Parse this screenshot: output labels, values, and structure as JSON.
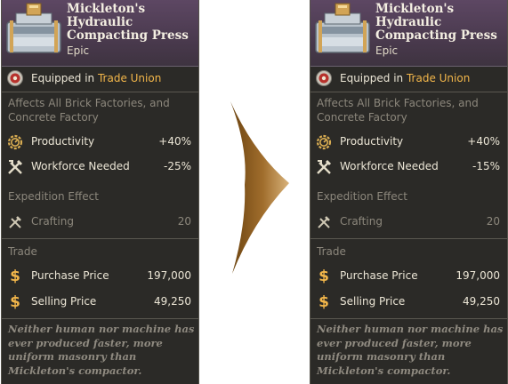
{
  "before": {
    "title": "Mickleton's Hydraulic Compacting Press",
    "rarity": "Epic",
    "equipped_prefix": "Equipped in",
    "equipped_place": "Trade Union",
    "affects": "Affects All Brick Factories, and Concrete Factory",
    "stats": [
      {
        "label": "Productivity",
        "value": "+40%",
        "icon": "gear-icon"
      },
      {
        "label": "Workforce Needed",
        "value": "-25%",
        "icon": "crossed-tools-icon"
      }
    ],
    "expedition_header": "Expedition Effect",
    "expedition": {
      "label": "Crafting",
      "value": "20",
      "icon": "crafting-tools-icon"
    },
    "trade_header": "Trade",
    "purchase": {
      "label": "Purchase Price",
      "value": "197,000",
      "icon": "dollar-icon"
    },
    "selling": {
      "label": "Selling Price",
      "value": "49,250",
      "icon": "dollar-icon"
    },
    "flavor": "Neither human nor machine has ever produced faster, more uniform masonry than Mickleton's compactor."
  },
  "after": {
    "title": "Mickleton's Hydraulic Compacting Press",
    "rarity": "Epic",
    "equipped_prefix": "Equipped in",
    "equipped_place": "Trade Union",
    "affects": "Affects All Brick Factories, and Concrete Factory",
    "stats": [
      {
        "label": "Productivity",
        "value": "+40%",
        "icon": "gear-icon"
      },
      {
        "label": "Workforce Needed",
        "value": "-15%",
        "icon": "crossed-tools-icon"
      }
    ],
    "expedition_header": "Expedition Effect",
    "expedition": {
      "label": "Crafting",
      "value": "20",
      "icon": "crafting-tools-icon"
    },
    "trade_header": "Trade",
    "purchase": {
      "label": "Purchase Price",
      "value": "197,000",
      "icon": "dollar-icon"
    },
    "selling": {
      "label": "Selling Price",
      "value": "49,250",
      "icon": "dollar-icon"
    },
    "flavor": "Neither human nor machine has ever produced faster, more uniform masonry than Mickleton's compactor."
  },
  "colors": {
    "accent": "#f2b64a",
    "header": "#5d4763",
    "panel": "#2b2a27",
    "arrow": "#8a5a1e"
  }
}
